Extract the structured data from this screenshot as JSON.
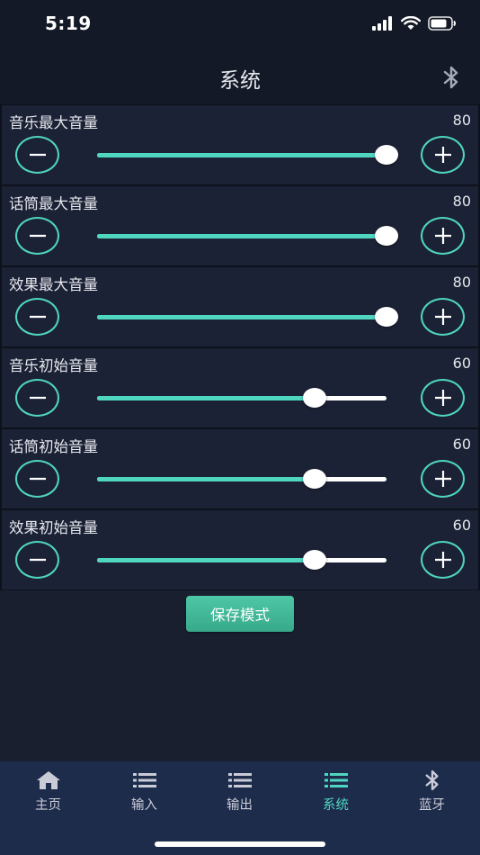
{
  "status": {
    "time": "5:19",
    "icons": [
      "cellular-signal-icon",
      "wifi-icon",
      "battery-icon"
    ]
  },
  "nav": {
    "title": "系统",
    "right_icon": "bluetooth-icon"
  },
  "colors": {
    "accent": "#4fd6c0",
    "background": "#1a1f30",
    "row_background": "#1c2235",
    "tab_bar": "#1e2c4c",
    "save_button": "#43b898"
  },
  "slider_max": 100,
  "sliders": [
    {
      "label": "音乐最大音量",
      "value": "80",
      "level": 1.0
    },
    {
      "label": "话筒最大音量",
      "value": "80",
      "level": 1.0
    },
    {
      "label": "效果最大音量",
      "value": "80",
      "level": 1.0
    },
    {
      "label": "音乐初始音量",
      "value": "60",
      "level": 0.75
    },
    {
      "label": "话筒初始音量",
      "value": "60",
      "level": 0.75
    },
    {
      "label": "效果初始音量",
      "value": "60",
      "level": 0.75
    }
  ],
  "save_button": {
    "label": "保存模式"
  },
  "tabs": [
    {
      "label": "主页",
      "icon": "home-icon",
      "active": false
    },
    {
      "label": "输入",
      "icon": "list-icon",
      "active": false
    },
    {
      "label": "输出",
      "icon": "list-icon",
      "active": false
    },
    {
      "label": "系统",
      "icon": "list-icon",
      "active": true
    },
    {
      "label": "蓝牙",
      "icon": "bluetooth-icon",
      "active": false
    }
  ]
}
